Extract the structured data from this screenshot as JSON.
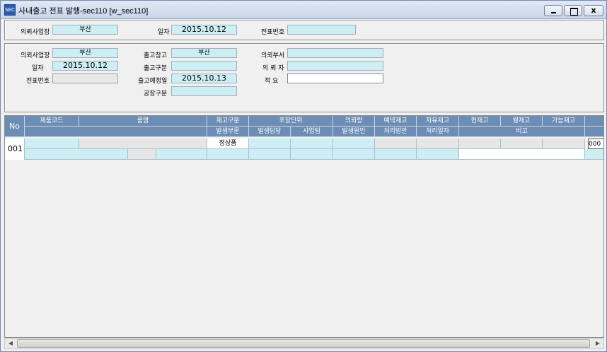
{
  "window": {
    "icon_text": "SEC",
    "title": "사내출고 전표  발행-sec110 [w_sec110]",
    "min_label": "",
    "max_label": "",
    "close_label": "x"
  },
  "top": {
    "req_site_label": "의뢰사업장",
    "req_site_value": "부산",
    "date_label": "일자",
    "date_value": "2015.10.12",
    "slip_no_label": "전표번호",
    "slip_no_value": ""
  },
  "detail": {
    "req_site_label": "의뢰사업장",
    "req_site_value": "부산",
    "date_label": "일자",
    "date_value": "2015.10.12",
    "slip_no_label": "전표번호",
    "slip_no_value": "",
    "out_wh_label": "출고창고",
    "out_wh_value": "부산",
    "out_type_label": "출고구분",
    "out_type_value": "",
    "planned_date_label": "출고예정일",
    "planned_date_value": "2015.10.13",
    "factory_type_label": "공장구분",
    "factory_type_value": "",
    "req_dept_label": "의뢰부서",
    "req_dept_value": "",
    "requester_label": "의 뢰 자",
    "requester_value": "",
    "remark_label": "적    요",
    "remark_value": ""
  },
  "grid": {
    "headers_row1": [
      "No",
      "제품코드",
      "품명",
      "재고구분",
      "포장단위",
      "의뢰량",
      "예약재고",
      "자유재고",
      "현재고",
      "월재고",
      "가능재고"
    ],
    "headers_row2": [
      "발생부문",
      "발생담당",
      "사업팀",
      "발생원인",
      "처리방안",
      "처리일자",
      "비고"
    ],
    "rows": [
      {
        "no": "001",
        "stock_type": "정상품",
        "overflow_text": "000"
      }
    ]
  }
}
